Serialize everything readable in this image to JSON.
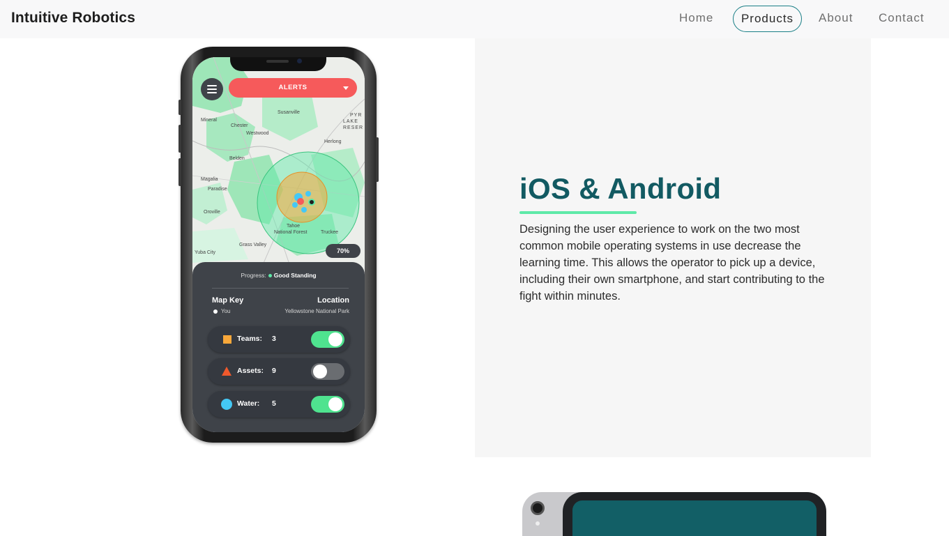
{
  "navbar": {
    "brand": "Intuitive Robotics",
    "links": [
      "Home",
      "Products",
      "About",
      "Contact"
    ],
    "active": "Products",
    "accent": "#1a7f86"
  },
  "feature": {
    "title": "iOS & Android",
    "title_color": "#125a62",
    "underline_color": "#5ee9a8",
    "description": "Designing the user experience to work on the two most common mobile operating systems in use decrease the learning time. This allows the operator to pick up a device, including their own smartphone, and start contributing to the fight within minutes."
  },
  "phone_app": {
    "menu_icon": "hamburger-menu-icon",
    "alerts_label": "ALERTS",
    "alerts_color": "#f65a5b",
    "coverage": "70%",
    "map_labels": [
      "Mineral",
      "Chester",
      "Westwood",
      "Susanville",
      "PYR",
      "LAKE",
      "RESER",
      "Herlong",
      "Belden",
      "Magalia",
      "Paradise",
      "Oroville",
      "Tahoe",
      "National Forest",
      "Truckee",
      "Grass Valley",
      "Yuba City"
    ],
    "progress_label": "Progress:",
    "progress_value": "Good Standing",
    "map_key_label": "Map Key",
    "you_label": "You",
    "location_label": "Location",
    "location_value": "Yellowstone National Park",
    "key_items": [
      {
        "label": "Teams:",
        "count": "3",
        "shape": "square",
        "color": "#f9a83a",
        "enabled": true
      },
      {
        "label": "Assets:",
        "count": "9",
        "shape": "triangle",
        "color": "#f0592c",
        "enabled": false
      },
      {
        "label": "Water:",
        "count": "5",
        "shape": "circle",
        "color": "#44c8f5",
        "enabled": true
      }
    ]
  }
}
